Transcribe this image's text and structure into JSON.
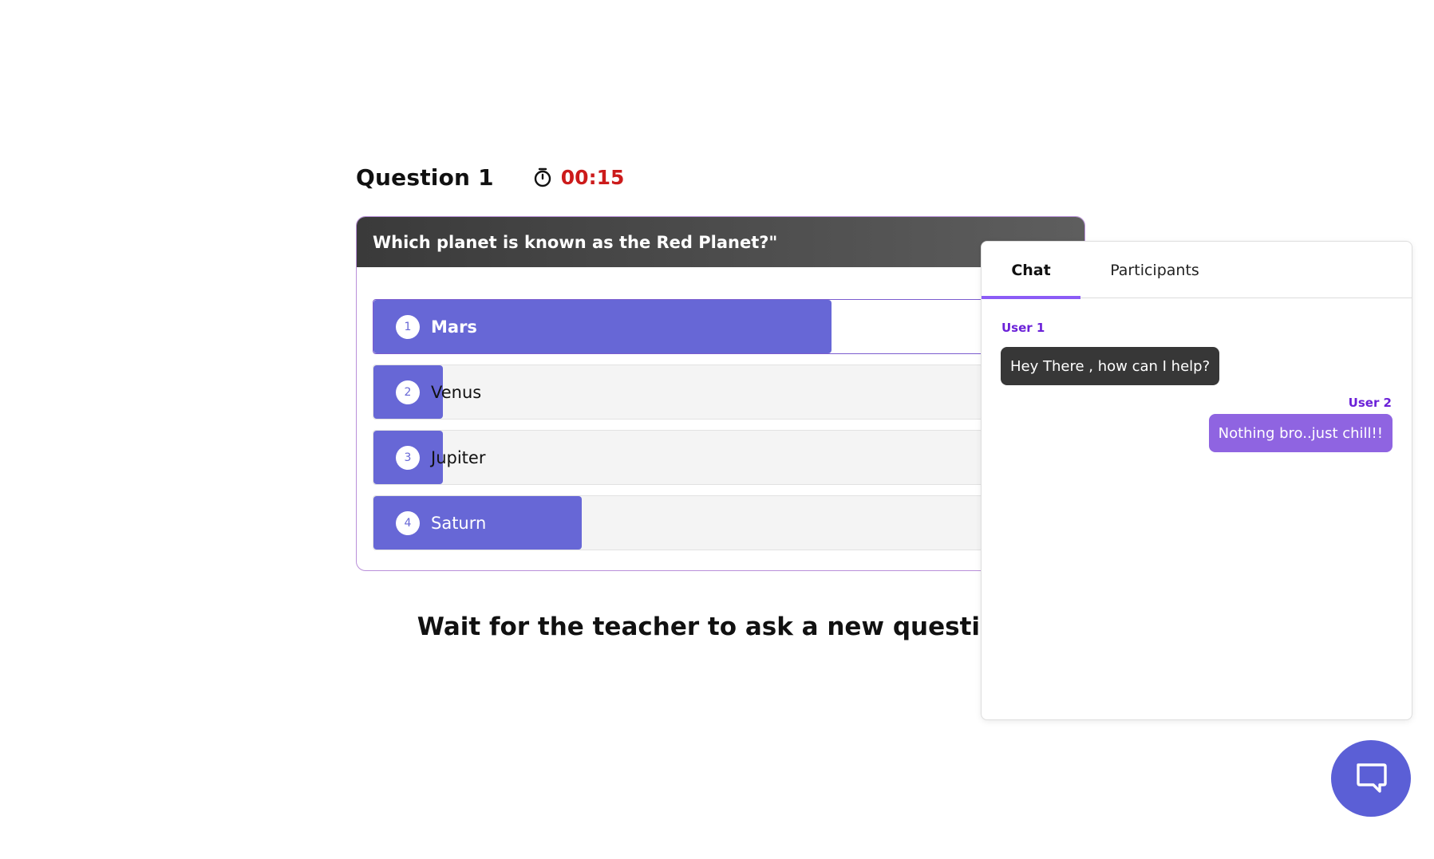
{
  "question": {
    "title": "Question 1",
    "timer": "00:15",
    "text": "Which planet is known as the Red Planet?\"",
    "options": [
      {
        "number": "1",
        "label": "Mars",
        "fill": 0.66,
        "selected": true
      },
      {
        "number": "2",
        "label": "Venus",
        "fill": 0.1,
        "selected": false
      },
      {
        "number": "3",
        "label": "Jupiter",
        "fill": 0.1,
        "selected": false
      },
      {
        "number": "4",
        "label": "Saturn",
        "fill": 0.3,
        "selected": false
      }
    ]
  },
  "wait_message": "Wait for the teacher to ask a new question.",
  "chat": {
    "tabs": [
      "Chat",
      "Participants"
    ],
    "messages": [
      {
        "user": "User 1",
        "text": "Hey There , how can I help?"
      },
      {
        "user": "User 2",
        "text": "Nothing bro..just chill!!"
      }
    ]
  },
  "colors": {
    "accent": "#6767d6",
    "timer": "#cc1b1b",
    "chat_accent": "#8b5cf6",
    "fab": "#5b5fd6"
  },
  "icons": {
    "timer": "stopwatch-icon",
    "fab": "chat-bubble-icon"
  }
}
